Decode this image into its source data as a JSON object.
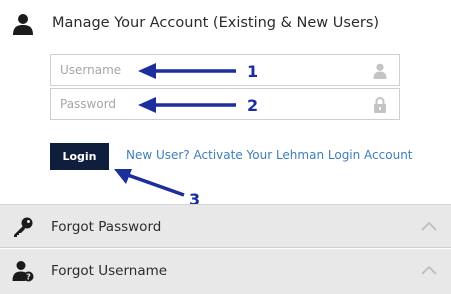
{
  "account": {
    "title": "Manage Your Account (Existing & New Users)",
    "username_placeholder": "Username",
    "password_placeholder": "Password",
    "login_label": "Login",
    "activate_link": "New User? Activate Your Lehman Login Account"
  },
  "annotations": {
    "one": "1",
    "two": "2",
    "three": "3",
    "color": "#1a2e9c"
  },
  "accordion": {
    "forgot_password": "Forgot Password",
    "forgot_username": "Forgot Username"
  },
  "icons": {
    "header": "user-icon",
    "username": "user-icon",
    "password": "lock-icon",
    "forgot_password": "key-icon",
    "forgot_username": "user-question-icon",
    "chevrons": "chevron-up-icon"
  },
  "colors": {
    "button_bg": "#0f1e3d",
    "link": "#3d7fb8",
    "accordion_bg": "#e8e8e8"
  }
}
